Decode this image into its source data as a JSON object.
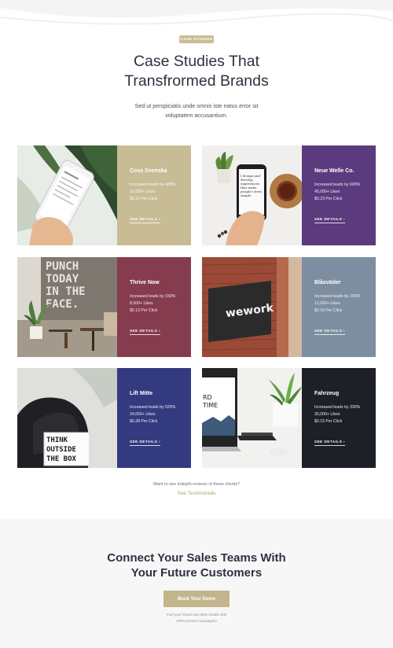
{
  "header": {
    "badge": "CASE STUDIES",
    "title_line1": "Case Studies That",
    "title_line2": "Transfrormed Brands",
    "subtitle_line1": "Sed ut perspiciatis unde omnis iste natus error sit",
    "subtitle_line2": "voluptatem accusantium."
  },
  "cards": [
    {
      "name": "Coss Svenska",
      "stats": [
        "Increased leads by 425%",
        "31,000+ Likes",
        "$3.16 Per Click"
      ],
      "link": "SEE DETAILS ›",
      "color": "#c7bc94"
    },
    {
      "name": "Neue Welle Co.",
      "stats": [
        "Increased leads by 600%",
        "45,000+ Likes",
        "$0.23 Per Click"
      ],
      "link": "SEE DETAILS ›",
      "color": "#5c3a7e"
    },
    {
      "name": "Thrive Now",
      "stats": [
        "Increased leads by 150%",
        "8,000+ Likes",
        "$0.13 Per Click"
      ],
      "link": "SEE DETAILS ›",
      "color": "#843c4e"
    },
    {
      "name": "Blåsväder",
      "stats": [
        "Increased leads by 200%",
        "12,000+ Likes",
        "$0.16 Per Click"
      ],
      "link": "SEE DETAILS ›",
      "color": "#7d8ea0"
    },
    {
      "name": "Lift Mitte",
      "stats": [
        "Increased leads by 525%",
        "24,000+ Likes",
        "$0.28 Per Click"
      ],
      "link": "SEE DETAILS ›",
      "color": "#333a7f"
    },
    {
      "name": "Fahrzeug",
      "stats": [
        "Increased leads by 330%",
        "30,000+ Likes",
        "$0.15 Per Click"
      ],
      "link": "SEE DETAILS ›",
      "color": "#1d2027"
    }
  ],
  "photos": {
    "punch_sign": [
      "PUNCH",
      "TODAY",
      "IN THE",
      "FACE."
    ],
    "wework_sign": "wework",
    "think_box": [
      "THINK",
      "OUTSIDE",
      "THE  BOX"
    ],
    "phone_screen_text": [
      "I design and",
      "develop",
      "experiences",
      "that make",
      "people's lives",
      "simple."
    ],
    "laptop_screen_text": [
      "RD",
      "TIME"
    ]
  },
  "reviews": {
    "note": "Want to see indepth reviews of these clients?",
    "link": "See Testimonials"
  },
  "cta": {
    "title_line1": "Connect Your Sales Teams With",
    "title_line2": "Your Future Customers",
    "button": "Book Your Demo",
    "note_line1": "Fuel your brand and drive results with",
    "note_line2": "100% proven campaigns!"
  }
}
